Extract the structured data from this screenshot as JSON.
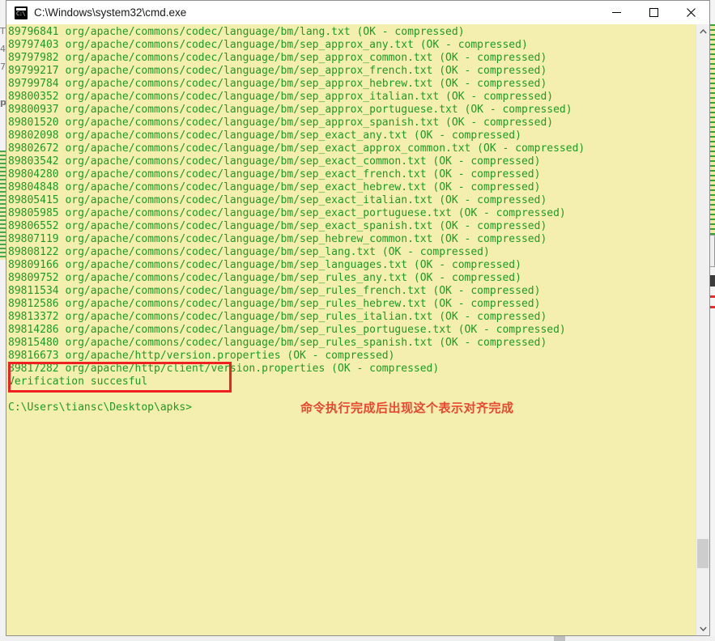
{
  "window": {
    "title": "C:\\Windows\\system32\\cmd.exe",
    "icon": "cmd-console-icon",
    "controls": {
      "minimize": "minimize",
      "maximize": "maximize",
      "close": "close"
    },
    "colors": {
      "console_background": "#f4efaf",
      "console_text": "#1e9a24",
      "annotation": "#e8482f",
      "highlight_box": "#ee2020",
      "titlebar_background": "#ffffff"
    }
  },
  "console": {
    "lines": [
      "89796841 org/apache/commons/codec/language/bm/lang.txt (OK - compressed)",
      "89797403 org/apache/commons/codec/language/bm/sep_approx_any.txt (OK - compressed)",
      "89797982 org/apache/commons/codec/language/bm/sep_approx_common.txt (OK - compressed)",
      "89799217 org/apache/commons/codec/language/bm/sep_approx_french.txt (OK - compressed)",
      "89799784 org/apache/commons/codec/language/bm/sep_approx_hebrew.txt (OK - compressed)",
      "89800352 org/apache/commons/codec/language/bm/sep_approx_italian.txt (OK - compressed)",
      "89800937 org/apache/commons/codec/language/bm/sep_approx_portuguese.txt (OK - compressed)",
      "89801520 org/apache/commons/codec/language/bm/sep_approx_spanish.txt (OK - compressed)",
      "89802098 org/apache/commons/codec/language/bm/sep_exact_any.txt (OK - compressed)",
      "89802672 org/apache/commons/codec/language/bm/sep_exact_approx_common.txt (OK - compressed)",
      "89803542 org/apache/commons/codec/language/bm/sep_exact_common.txt (OK - compressed)",
      "89804280 org/apache/commons/codec/language/bm/sep_exact_french.txt (OK - compressed)",
      "89804848 org/apache/commons/codec/language/bm/sep_exact_hebrew.txt (OK - compressed)",
      "89805415 org/apache/commons/codec/language/bm/sep_exact_italian.txt (OK - compressed)",
      "89805985 org/apache/commons/codec/language/bm/sep_exact_portuguese.txt (OK - compressed)",
      "89806552 org/apache/commons/codec/language/bm/sep_exact_spanish.txt (OK - compressed)",
      "89807119 org/apache/commons/codec/language/bm/sep_hebrew_common.txt (OK - compressed)",
      "89808122 org/apache/commons/codec/language/bm/sep_lang.txt (OK - compressed)",
      "89809166 org/apache/commons/codec/language/bm/sep_languages.txt (OK - compressed)",
      "89809752 org/apache/commons/codec/language/bm/sep_rules_any.txt (OK - compressed)",
      "89811534 org/apache/commons/codec/language/bm/sep_rules_french.txt (OK - compressed)",
      "89812586 org/apache/commons/codec/language/bm/sep_rules_hebrew.txt (OK - compressed)",
      "89813372 org/apache/commons/codec/language/bm/sep_rules_italian.txt (OK - compressed)",
      "89814286 org/apache/commons/codec/language/bm/sep_rules_portuguese.txt (OK - compressed)",
      "89815480 org/apache/commons/codec/language/bm/sep_rules_spanish.txt (OK - compressed)",
      "89816673 org/apache/http/version.properties (OK - compressed)",
      "89817282 org/apache/http/client/version.properties (OK - compressed)",
      "Verification succesful",
      "",
      "C:\\Users\\tiansc\\Desktop\\apks>"
    ]
  },
  "annotation": {
    "text": "命令执行完成后出现这个表示对齐完成"
  },
  "scrollbar": {
    "up_arrow": "chevron-up-icon",
    "down_arrow": "chevron-down-icon"
  },
  "background": {
    "left_glyphs": "T\n4\n7\n\np"
  }
}
